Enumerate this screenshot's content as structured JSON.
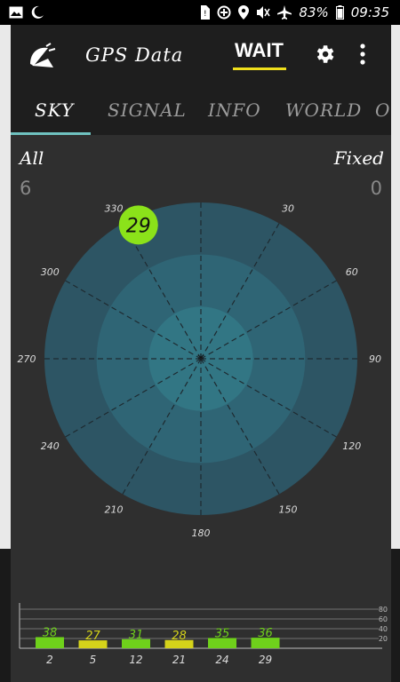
{
  "status_bar": {
    "left_icons": [
      "image-icon",
      "moon-icon"
    ],
    "right_icons": [
      "sim-alert-icon",
      "data-saver-icon",
      "location-icon",
      "mute-icon",
      "airplane-icon"
    ],
    "battery": "83%",
    "time": "09:35"
  },
  "app_bar": {
    "title": "GPS Data",
    "status_button": "WAIT",
    "accent": "#f0e01c"
  },
  "tabs": [
    {
      "label": "SKY",
      "active": true
    },
    {
      "label": "SIGNAL",
      "active": false
    },
    {
      "label": "INFO",
      "active": false
    },
    {
      "label": "WORLD",
      "active": false
    },
    {
      "label": "OT",
      "active": false
    }
  ],
  "sky": {
    "all_label": "All",
    "fixed_label": "Fixed",
    "all_count": "6",
    "fixed_count": "0",
    "azimuth_labels": [
      "30",
      "60",
      "90",
      "120",
      "150",
      "180",
      "210",
      "240",
      "270",
      "300",
      "330"
    ],
    "satellites": [
      {
        "id": "29",
        "azimuth": 335,
        "elevation": 5,
        "color": "#8be21a"
      }
    ],
    "ring_colors": [
      "#2d5564",
      "#2f6575",
      "#327684"
    ]
  },
  "signal": {
    "scale_labels": [
      "80",
      "60",
      "40",
      "20"
    ],
    "bars": [
      {
        "prn": "2",
        "snr": 38,
        "color": "#6fd11b"
      },
      {
        "prn": "5",
        "snr": 27,
        "color": "#d5d31a"
      },
      {
        "prn": "12",
        "snr": 31,
        "color": "#6fd11b"
      },
      {
        "prn": "21",
        "snr": 28,
        "color": "#d5d31a"
      },
      {
        "prn": "24",
        "snr": 35,
        "color": "#6fd11b"
      },
      {
        "prn": "29",
        "snr": 36,
        "color": "#6fd11b"
      }
    ]
  }
}
